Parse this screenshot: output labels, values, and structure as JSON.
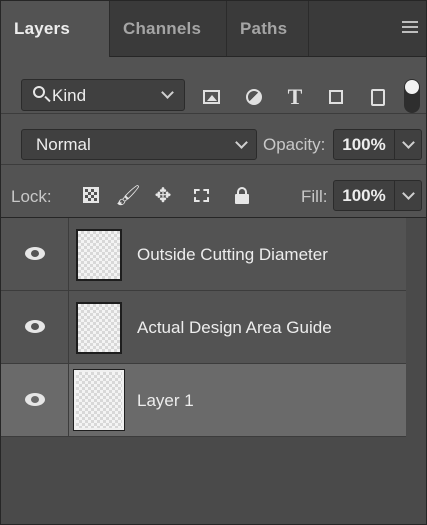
{
  "tabs": [
    {
      "label": "Layers",
      "active": true
    },
    {
      "label": "Channels",
      "active": false
    },
    {
      "label": "Paths",
      "active": false
    }
  ],
  "filter": {
    "kind_label": "Kind",
    "icons": [
      "image-filter-icon",
      "adjustment-filter-icon",
      "type-filter-icon",
      "shape-filter-icon",
      "smart-object-filter-icon"
    ],
    "type_glyph": "T",
    "filter_toggle_on": true
  },
  "blend": {
    "mode": "Normal",
    "opacity_label": "Opacity:",
    "opacity_value": "100%"
  },
  "lock": {
    "label": "Lock:",
    "brush_glyph": "🖌",
    "move_glyph": "✥",
    "fill_label": "Fill:",
    "fill_value": "100%"
  },
  "layers": [
    {
      "name": "Outside Cutting Diameter",
      "visible": true,
      "selected": false
    },
    {
      "name": "Actual Design Area Guide",
      "visible": true,
      "selected": false
    },
    {
      "name": "Layer 1",
      "visible": true,
      "selected": true
    }
  ],
  "colors": {
    "panel_bg": "#535353",
    "selected_row_bg": "#6a6a6a",
    "tab_bar_bg": "#3a3a3a"
  }
}
